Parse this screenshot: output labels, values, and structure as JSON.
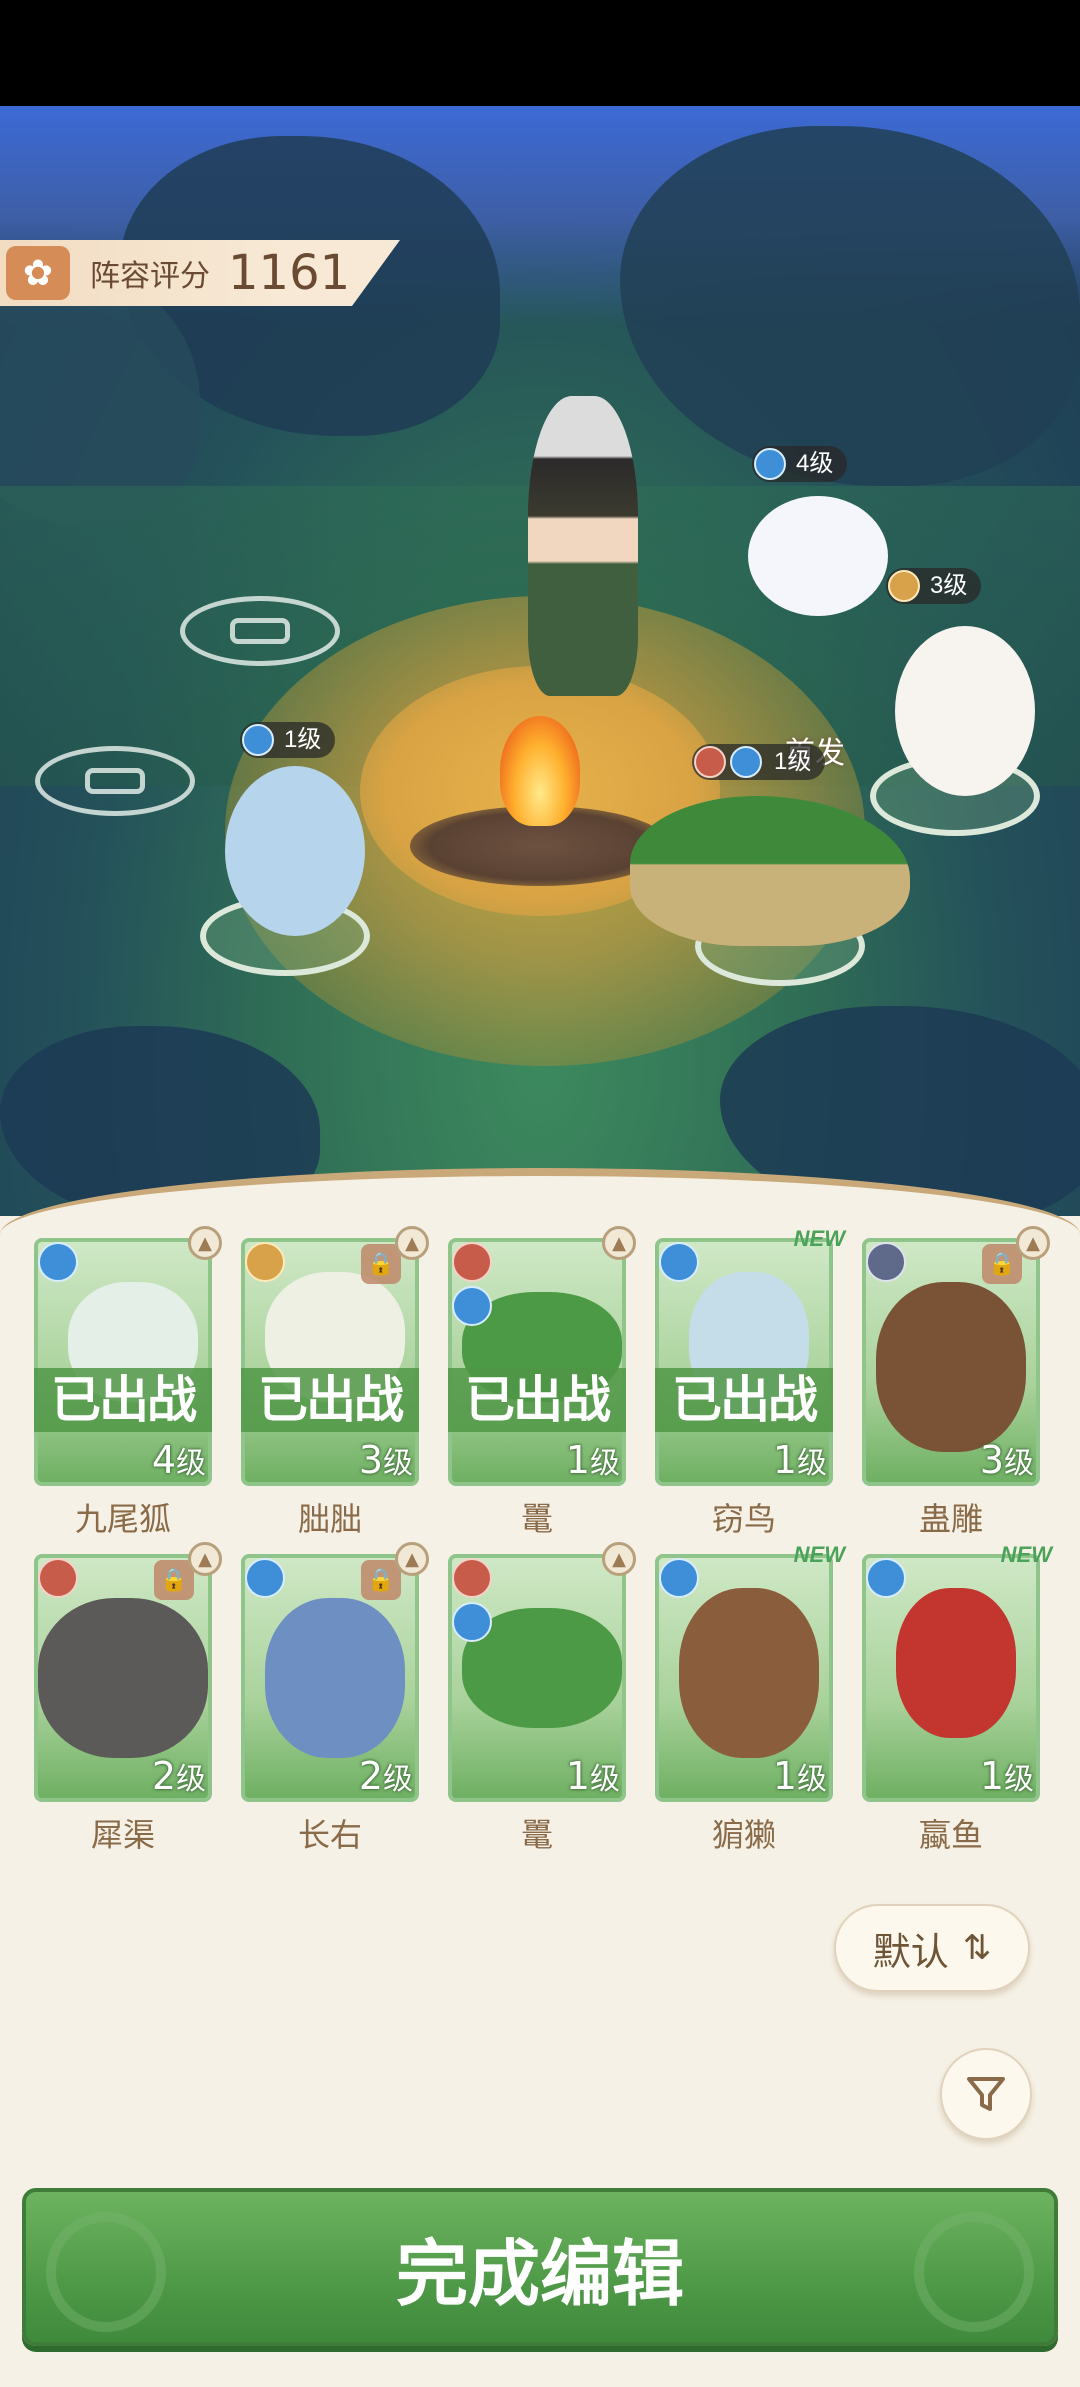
{
  "header": {
    "score_label": "阵容评分",
    "score_value": "1161"
  },
  "battlefield": {
    "first_label": "首发",
    "tags": [
      {
        "name": "nine-tail-fox",
        "level": "4级",
        "element": "water"
      },
      {
        "name": "white-cat",
        "level": "3级",
        "element": "gold"
      },
      {
        "name": "duck",
        "level": "1级",
        "element": "water"
      },
      {
        "name": "crocodile",
        "level": "1级",
        "element": "fire-water"
      }
    ]
  },
  "cards": [
    {
      "name": "九尾狐",
      "level_num": "4",
      "level_unit": "级",
      "element": "water",
      "deployed": "已出战",
      "lock": false,
      "up": true,
      "new": false
    },
    {
      "name": "胐胐",
      "level_num": "3",
      "level_unit": "级",
      "element": "gold",
      "deployed": "已出战",
      "lock": true,
      "up": true,
      "new": false
    },
    {
      "name": "鼍",
      "level_num": "1",
      "level_unit": "级",
      "element": "fire-water",
      "deployed": "已出战",
      "lock": false,
      "up": true,
      "new": false
    },
    {
      "name": "窃鸟",
      "level_num": "1",
      "level_unit": "级",
      "element": "water",
      "deployed": "已出战",
      "lock": false,
      "up": false,
      "new": true
    },
    {
      "name": "蛊雕",
      "level_num": "3",
      "level_unit": "级",
      "element": "dark",
      "deployed": "",
      "lock": true,
      "up": true,
      "new": false
    },
    {
      "name": "犀渠",
      "level_num": "2",
      "level_unit": "级",
      "element": "fire",
      "deployed": "",
      "lock": true,
      "up": true,
      "new": false
    },
    {
      "name": "长右",
      "level_num": "2",
      "level_unit": "级",
      "element": "water",
      "deployed": "",
      "lock": true,
      "up": true,
      "new": false
    },
    {
      "name": "鼍",
      "level_num": "1",
      "level_unit": "级",
      "element": "fire-water",
      "deployed": "",
      "lock": false,
      "up": true,
      "new": false
    },
    {
      "name": "猏獭",
      "level_num": "1",
      "level_unit": "级",
      "element": "water",
      "deployed": "",
      "lock": false,
      "up": false,
      "new": true
    },
    {
      "name": "蠃鱼",
      "level_num": "1",
      "level_unit": "级",
      "element": "water",
      "deployed": "",
      "lock": false,
      "up": false,
      "new": true
    }
  ],
  "new_badge": "NEW",
  "sort_button": {
    "label": "默认",
    "icon": "sort-toggle-icon"
  },
  "filter_button": {
    "icon": "filter-icon"
  },
  "done_button": {
    "label": "完成编辑"
  },
  "colors": {
    "accent_green": "#4f9a48",
    "text_brown": "#8a6b49",
    "panel_bg": "#f6f1e6"
  }
}
